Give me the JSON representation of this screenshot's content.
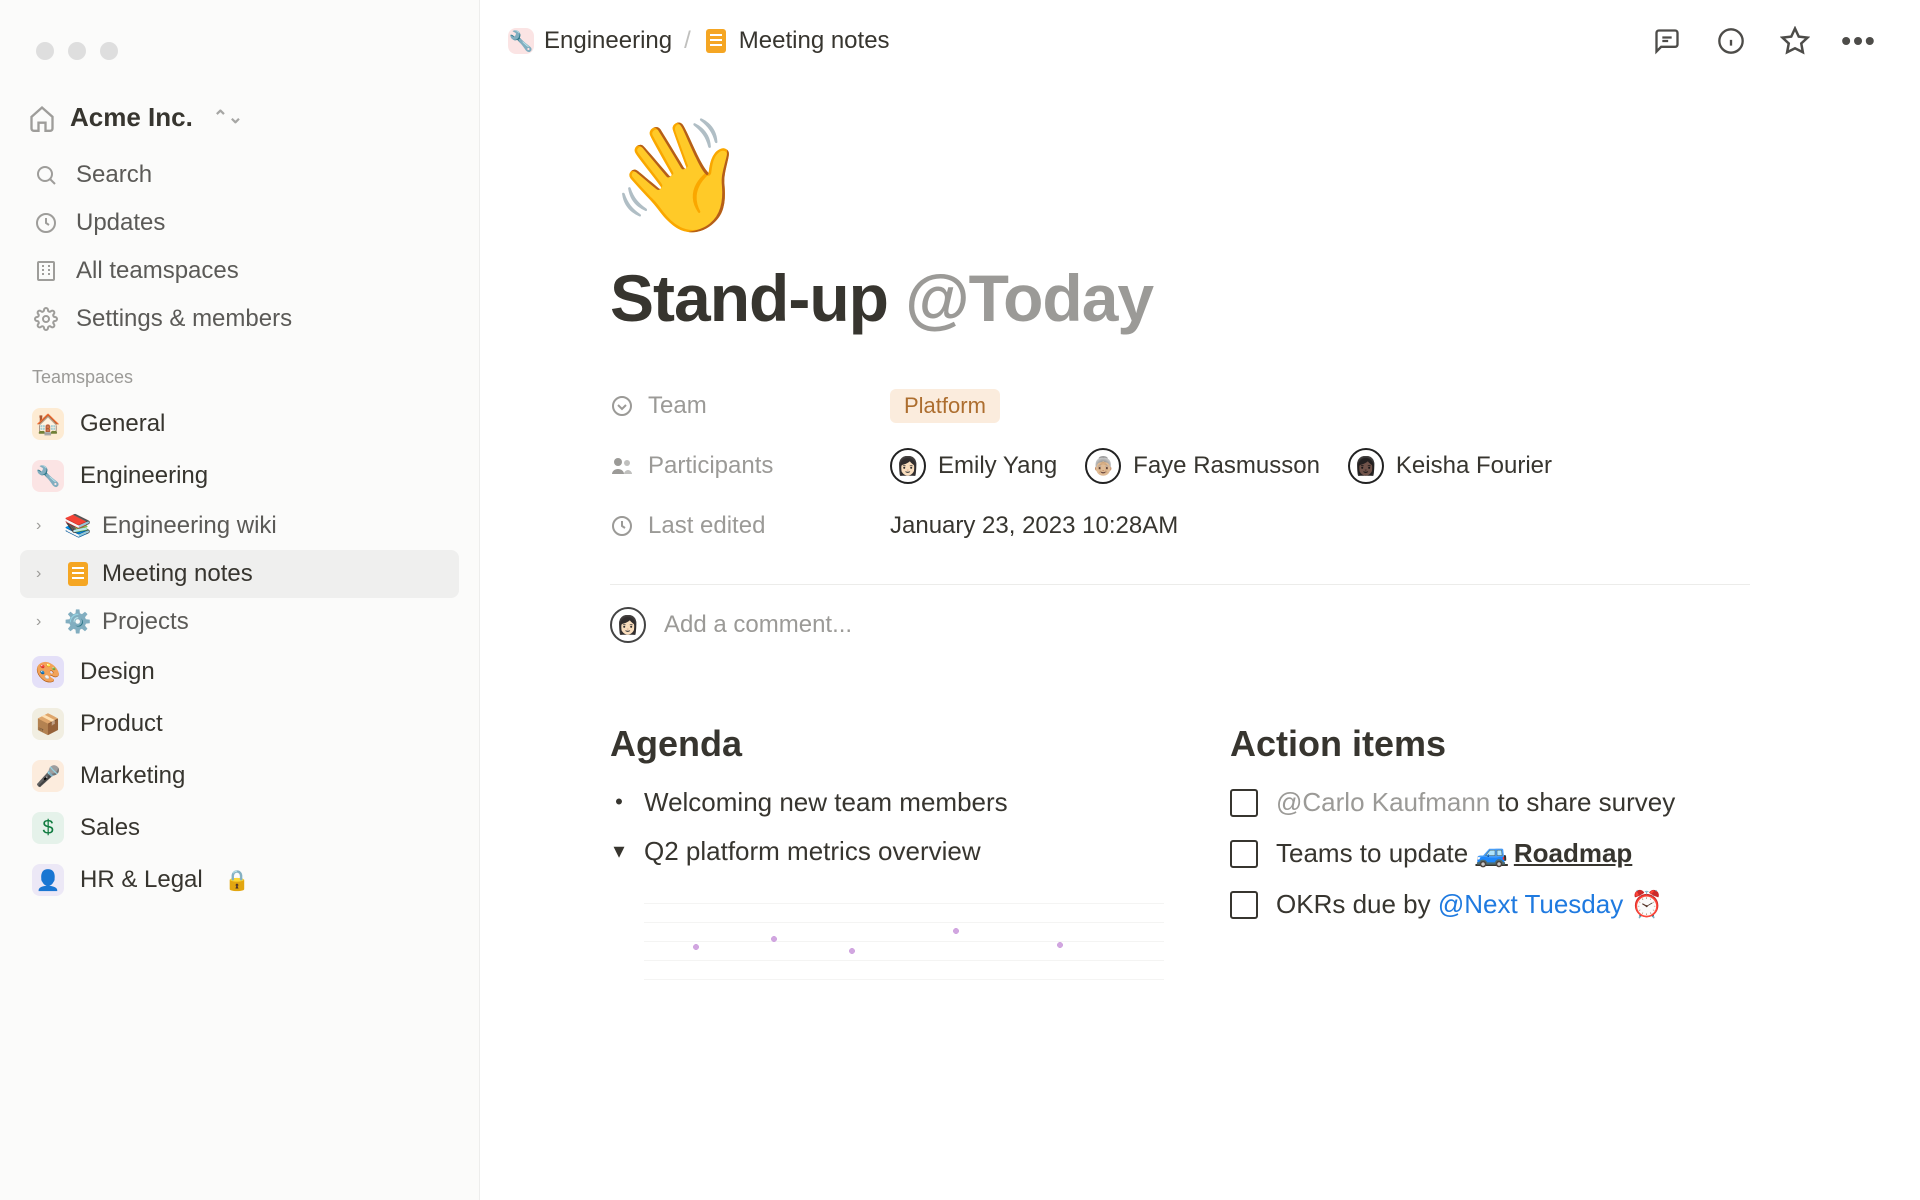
{
  "workspace": {
    "name": "Acme Inc."
  },
  "sidebar": {
    "nav": {
      "search": "Search",
      "updates": "Updates",
      "teamspaces": "All teamspaces",
      "settings": "Settings & members"
    },
    "section_label": "Teamspaces",
    "teamspaces": [
      {
        "name": "General",
        "icon": "🏠",
        "badge": "b-home"
      },
      {
        "name": "Engineering",
        "icon": "🔧",
        "badge": "b-eng",
        "children": [
          {
            "name": "Engineering wiki",
            "icon": "📚"
          },
          {
            "name": "Meeting notes",
            "icon": "note",
            "active": true
          },
          {
            "name": "Projects",
            "icon": "⚙️"
          }
        ]
      },
      {
        "name": "Design",
        "icon": "🎨",
        "badge": "b-des"
      },
      {
        "name": "Product",
        "icon": "📦",
        "badge": "b-prd"
      },
      {
        "name": "Marketing",
        "icon": "🎤",
        "badge": "b-mkt"
      },
      {
        "name": "Sales",
        "icon": "$",
        "badge": "b-sal"
      },
      {
        "name": "HR & Legal",
        "icon": "👤",
        "badge": "b-hr",
        "locked": true
      }
    ]
  },
  "breadcrumbs": {
    "a": {
      "label": "Engineering",
      "icon": "🔧"
    },
    "b": {
      "label": "Meeting notes"
    }
  },
  "page": {
    "emoji": "👋",
    "title_text": "Stand-up ",
    "title_mention": "@Today"
  },
  "props": {
    "team": {
      "label": "Team",
      "value": "Platform"
    },
    "participants": {
      "label": "Participants",
      "people": [
        "Emily Yang",
        "Faye Rasmusson",
        "Keisha Fourier"
      ]
    },
    "edited": {
      "label": "Last edited",
      "value": "January 23, 2023 10:28AM"
    }
  },
  "comment_placeholder": "Add a comment...",
  "agenda": {
    "heading": "Agenda",
    "items": [
      {
        "mark": "•",
        "text": "Welcoming new team members"
      },
      {
        "mark": "▾",
        "text": "Q2 platform metrics overview"
      }
    ]
  },
  "actions": {
    "heading": "Action items",
    "items": [
      {
        "mention": "@Carlo Kaufmann",
        "rest": " to share survey"
      },
      {
        "prefix": "Teams to update ",
        "link": "Roadmap"
      },
      {
        "prefix": "OKRs due by ",
        "blue_mention": "@Next Tuesday"
      }
    ]
  }
}
